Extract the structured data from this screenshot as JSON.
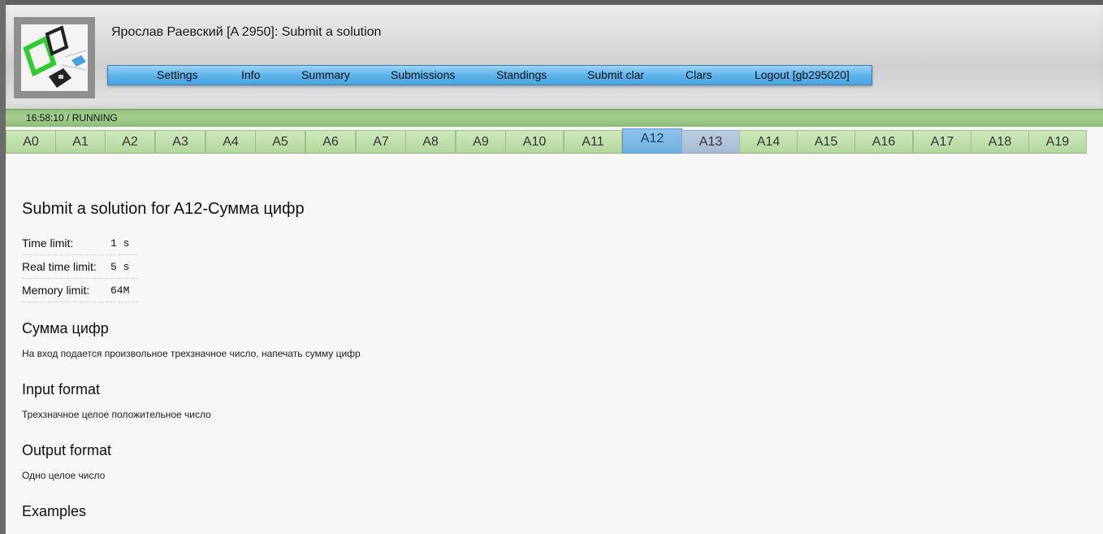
{
  "header": {
    "title": "Ярослав Раевский [A 2950]: Submit a solution",
    "logo_icon": "ejudge-logo-icon"
  },
  "menu": {
    "items": [
      {
        "label": "Settings"
      },
      {
        "label": "Info"
      },
      {
        "label": "Summary"
      },
      {
        "label": "Submissions"
      },
      {
        "label": "Standings"
      },
      {
        "label": "Submit clar"
      },
      {
        "label": "Clars"
      },
      {
        "label": "Logout [gb295020]"
      }
    ]
  },
  "status": {
    "text": "16:58:10 / RUNNING"
  },
  "problem_tabs": {
    "active": "A12",
    "items": [
      "A0",
      "A1",
      "A2",
      "A3",
      "A4",
      "A5",
      "A6",
      "A7",
      "A8",
      "A9",
      "A10",
      "A11",
      "A12",
      "A13",
      "A14",
      "A15",
      "A16",
      "A17",
      "A18",
      "A19"
    ]
  },
  "problem": {
    "heading": "Submit a solution for A12-Сумма цифр",
    "limits": [
      {
        "label": "Time limit:",
        "value": "1 s"
      },
      {
        "label": "Real time limit:",
        "value": "5 s"
      },
      {
        "label": "Memory limit:",
        "value": "64M"
      }
    ],
    "name": "Сумма цифр",
    "statement": "На вход подается произвольное трехзначное число, напечать сумму цифр",
    "input_heading": "Input format",
    "input_text": "Трехзначное целое положительное число",
    "output_heading": "Output format",
    "output_text": "Одно целое число",
    "examples_heading": "Examples"
  },
  "colors": {
    "menu_blue": "#5db3ea",
    "status_green": "#a5cf91",
    "tab_green": "#b3d79b",
    "tab_active": "#6eb0e0"
  }
}
